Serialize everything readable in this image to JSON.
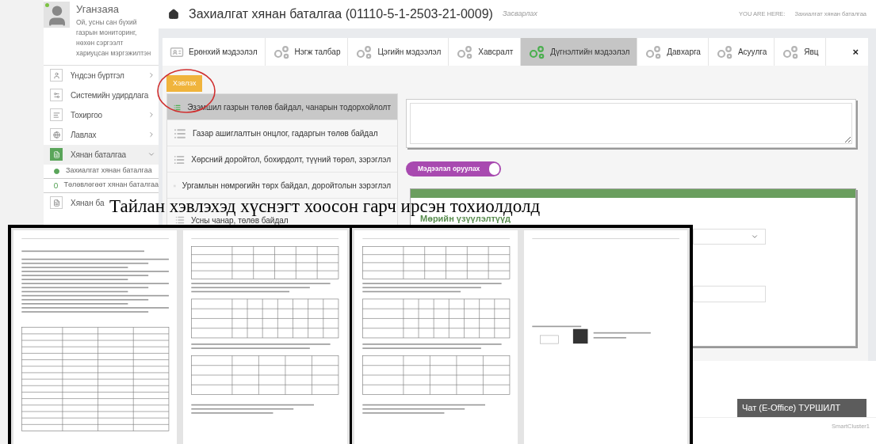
{
  "header": {
    "title": "Захиалгат хянан баталгаа (01110-5-1-2503-21-0009)",
    "edit_link": "Засварлах",
    "breadcrumb_label": "YOU ARE HERE:",
    "breadcrumb_current": "Захиалгат хянан баталгаа"
  },
  "user": {
    "name": "Уганзаяа",
    "role": "Ой, усны сан бүхий газрын мониторинг, нөхөн сэргээлт хариуцсан мэргэжилтэн",
    "online": true
  },
  "menu": [
    {
      "label": "Үндсэн бүртгэл",
      "expanded": false,
      "selected": false
    },
    {
      "label": "Системийн удирдлага",
      "selected": false
    },
    {
      "label": "Тохиргоо",
      "expanded": false,
      "selected": false
    },
    {
      "label": "Лавлах",
      "expanded": false,
      "selected": false
    },
    {
      "label": "Хянан баталгаа",
      "expanded": true,
      "selected": true,
      "children": [
        {
          "label": "Захиалгат хянан баталгаа",
          "selected": true
        },
        {
          "label": "Төлөвлөгөөт хянан баталгаа",
          "selected": false
        }
      ]
    },
    {
      "label": "Хянан ба",
      "selected": false
    }
  ],
  "tabs": [
    {
      "label": "Ерөнхий мэдээлэл",
      "selected": false
    },
    {
      "label": "Нэгж талбар",
      "selected": false
    },
    {
      "label": "Цэгийн мэдээлэл",
      "selected": false
    },
    {
      "label": "Хавсралт",
      "selected": false
    },
    {
      "label": "Дүгнэлтийн мэдээлэл",
      "selected": true
    },
    {
      "label": "Давхарга",
      "selected": false
    },
    {
      "label": "Асуулга",
      "selected": false
    },
    {
      "label": "Явц",
      "selected": false
    }
  ],
  "close_label": "×",
  "print_button": "Хэвлэх",
  "sections": [
    {
      "label": "Эзэмшил газрын төлөв байдал, чанарын тодорхойлолт",
      "selected": true
    },
    {
      "label": "Газар ашиглалтын онцлог, гадаргын төлөв байдал",
      "selected": false
    },
    {
      "label": "Хөрсний доройтол, бохирдолт, түүний төрөл, зэрэглэл",
      "selected": false
    },
    {
      "label": "Ургамлын нөмрөгийн төрх байдал, доройтолын зэрэглэл",
      "selected": false
    },
    {
      "label": "Усны чанар, төлөв байдал",
      "selected": false
    }
  ],
  "toggle": {
    "label": "Мэдээлэл оруулах",
    "on": true
  },
  "panel": {
    "title": "Мөрийн үзүүлэлтүүд"
  },
  "chat": "Чат (E-Office) ТУРШИЛТ",
  "footer": "SmartCluster1",
  "caption": "Тайлан хэвлэхэд хүснэгт хоосон гарч ирсэн тохиолдолд",
  "previews": [
    {
      "pages": [
        {
          "kind": "form"
        },
        {
          "kind": "tables"
        }
      ]
    },
    {
      "pages": [
        {
          "kind": "tables"
        },
        {
          "kind": "approval"
        }
      ]
    }
  ]
}
